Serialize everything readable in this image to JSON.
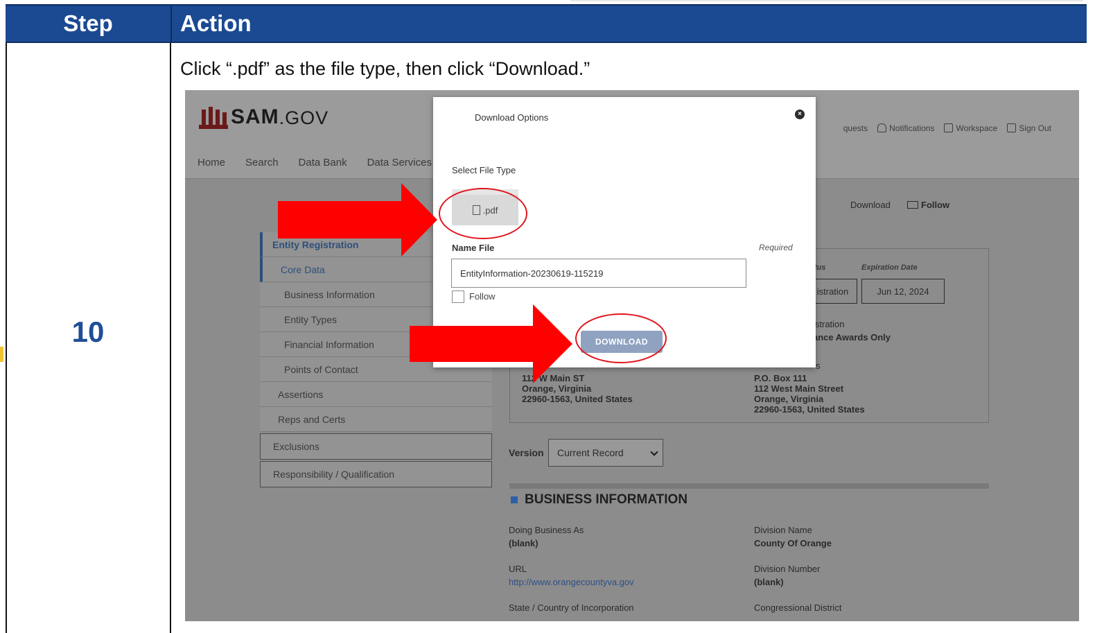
{
  "table": {
    "step_header": "Step",
    "action_header": "Action",
    "step_number": "10",
    "instruction": "Click “.pdf” as the file type, then click “Download.”"
  },
  "app": {
    "brand_sam": "SAM",
    "brand_gov": ".GOV",
    "nav": [
      "Home",
      "Search",
      "Data Bank",
      "Data Services"
    ],
    "top_links": {
      "requests": "quests",
      "notifications": "Notifications",
      "workspace": "Workspace",
      "sign_out": "Sign Out"
    },
    "page_actions": {
      "download": "Download",
      "follow": "Follow"
    },
    "sidebar": {
      "entity_registration": "Entity Registration",
      "core_data": "Core Data",
      "business_information": "Business Information",
      "entity_types": "Entity Types",
      "financial_information": "Financial Information",
      "points_of_contact": "Points of Contact",
      "assertions": "Assertions",
      "reps_and_certs": "Reps and Certs",
      "exclusions": "Exclusions",
      "responsibility": "Responsibility / Qualification"
    },
    "details": {
      "purpose_label": "tus",
      "purpose_value": "istration",
      "expiration_label": "Expiration Date",
      "expiration_value": "Jun 12, 2024",
      "reg_line1": "istration",
      "reg_line2": "ance Awards Only",
      "physical_address": [
        "112 W Main ST",
        "Orange, Virginia",
        "22960-1563, United States"
      ],
      "mailing_label": "s",
      "mailing_address": [
        "P.O. Box 111",
        "112 West Main Street",
        "Orange, Virginia",
        "22960-1563, United States"
      ]
    },
    "version_label": "Version",
    "version_value": "Current Record",
    "business_info_title": "BUSINESS INFORMATION",
    "business_info": {
      "dba_label": "Doing Business As",
      "dba_value": "(blank)",
      "division_name_label": "Division Name",
      "division_name_value": "County Of Orange",
      "url_label": "URL",
      "url_value": "http://www.orangecountyva.gov",
      "division_number_label": "Division Number",
      "division_number_value": "(blank)",
      "state_label": "State / Country of Incorporation",
      "congressional_label": "Congressional District"
    }
  },
  "modal": {
    "title": "Download Options",
    "close_glyph": "×",
    "select_label": "Select File Type",
    "pdf_label": ".pdf",
    "name_label": "Name File",
    "required_label": "Required",
    "name_value": "EntityInformation-20230619-115219",
    "follow_label": "Follow",
    "download_label": "DOWNLOAD"
  },
  "colors": {
    "header_blue": "#1b4a92",
    "step_number": "#1f4e96",
    "annotation_red": "#ff0000",
    "download_button": "#8fa3c0"
  }
}
